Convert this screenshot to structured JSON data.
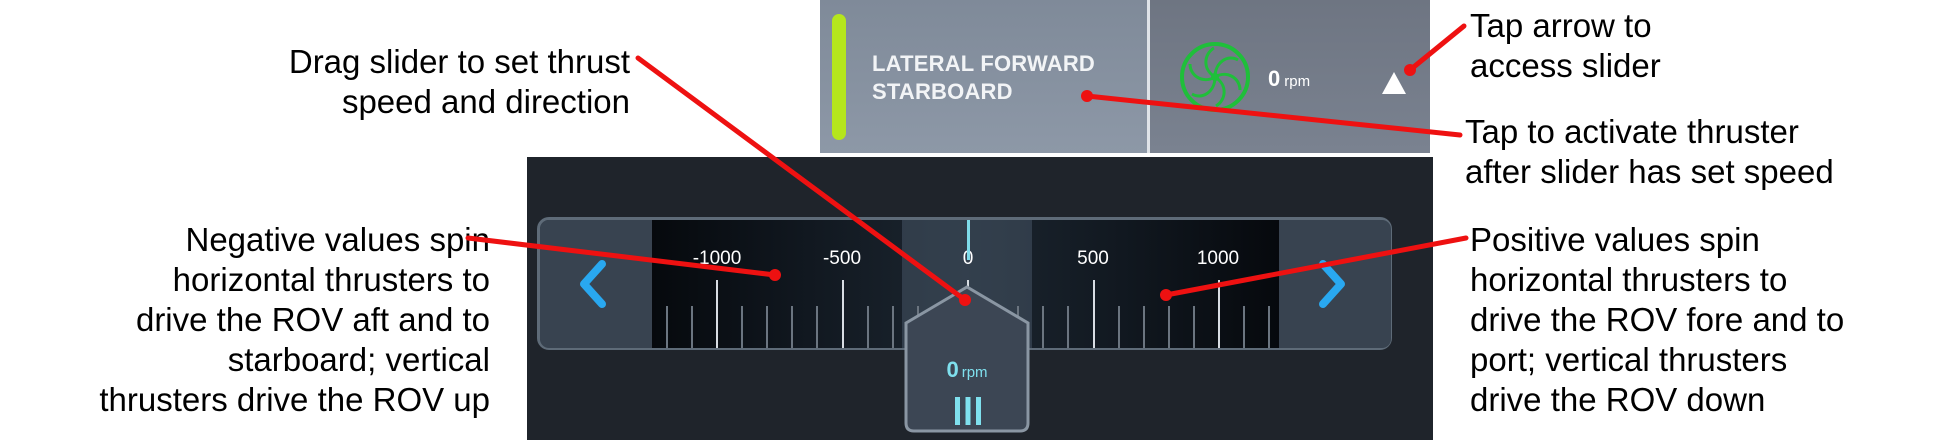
{
  "thruster": {
    "name_line1": "LATERAL FORWARD",
    "name_line2": "STARBOARD",
    "rpm_value": "0",
    "rpm_unit": "rpm",
    "status_color": "#b5e61d"
  },
  "slider": {
    "tick_labels": [
      "-1000",
      "-500",
      "0",
      "500",
      "1000"
    ],
    "value": "0",
    "unit": "rpm",
    "accent_color": "#7fe0ee"
  },
  "annotations": {
    "drag_slider": [
      "Drag slider to set thrust",
      "speed and direction"
    ],
    "tap_arrow": [
      "Tap arrow to",
      "access slider"
    ],
    "tap_activate": [
      "Tap to activate thruster",
      "after slider has set speed"
    ],
    "negative_values": [
      "Negative values spin",
      "horizontal thrusters to",
      "drive the ROV aft and to",
      "starboard; vertical",
      "thrusters drive the ROV up"
    ],
    "positive_values": [
      "Positive values spin",
      "horizontal thrusters to",
      "drive the ROV fore and to",
      "port; vertical thrusters",
      "drive the ROV down"
    ]
  },
  "icons": [
    "fan-icon",
    "expand-arrow-icon",
    "chevron-left-icon",
    "chevron-right-icon",
    "grip-icon"
  ],
  "callout_color": "#ee1111"
}
